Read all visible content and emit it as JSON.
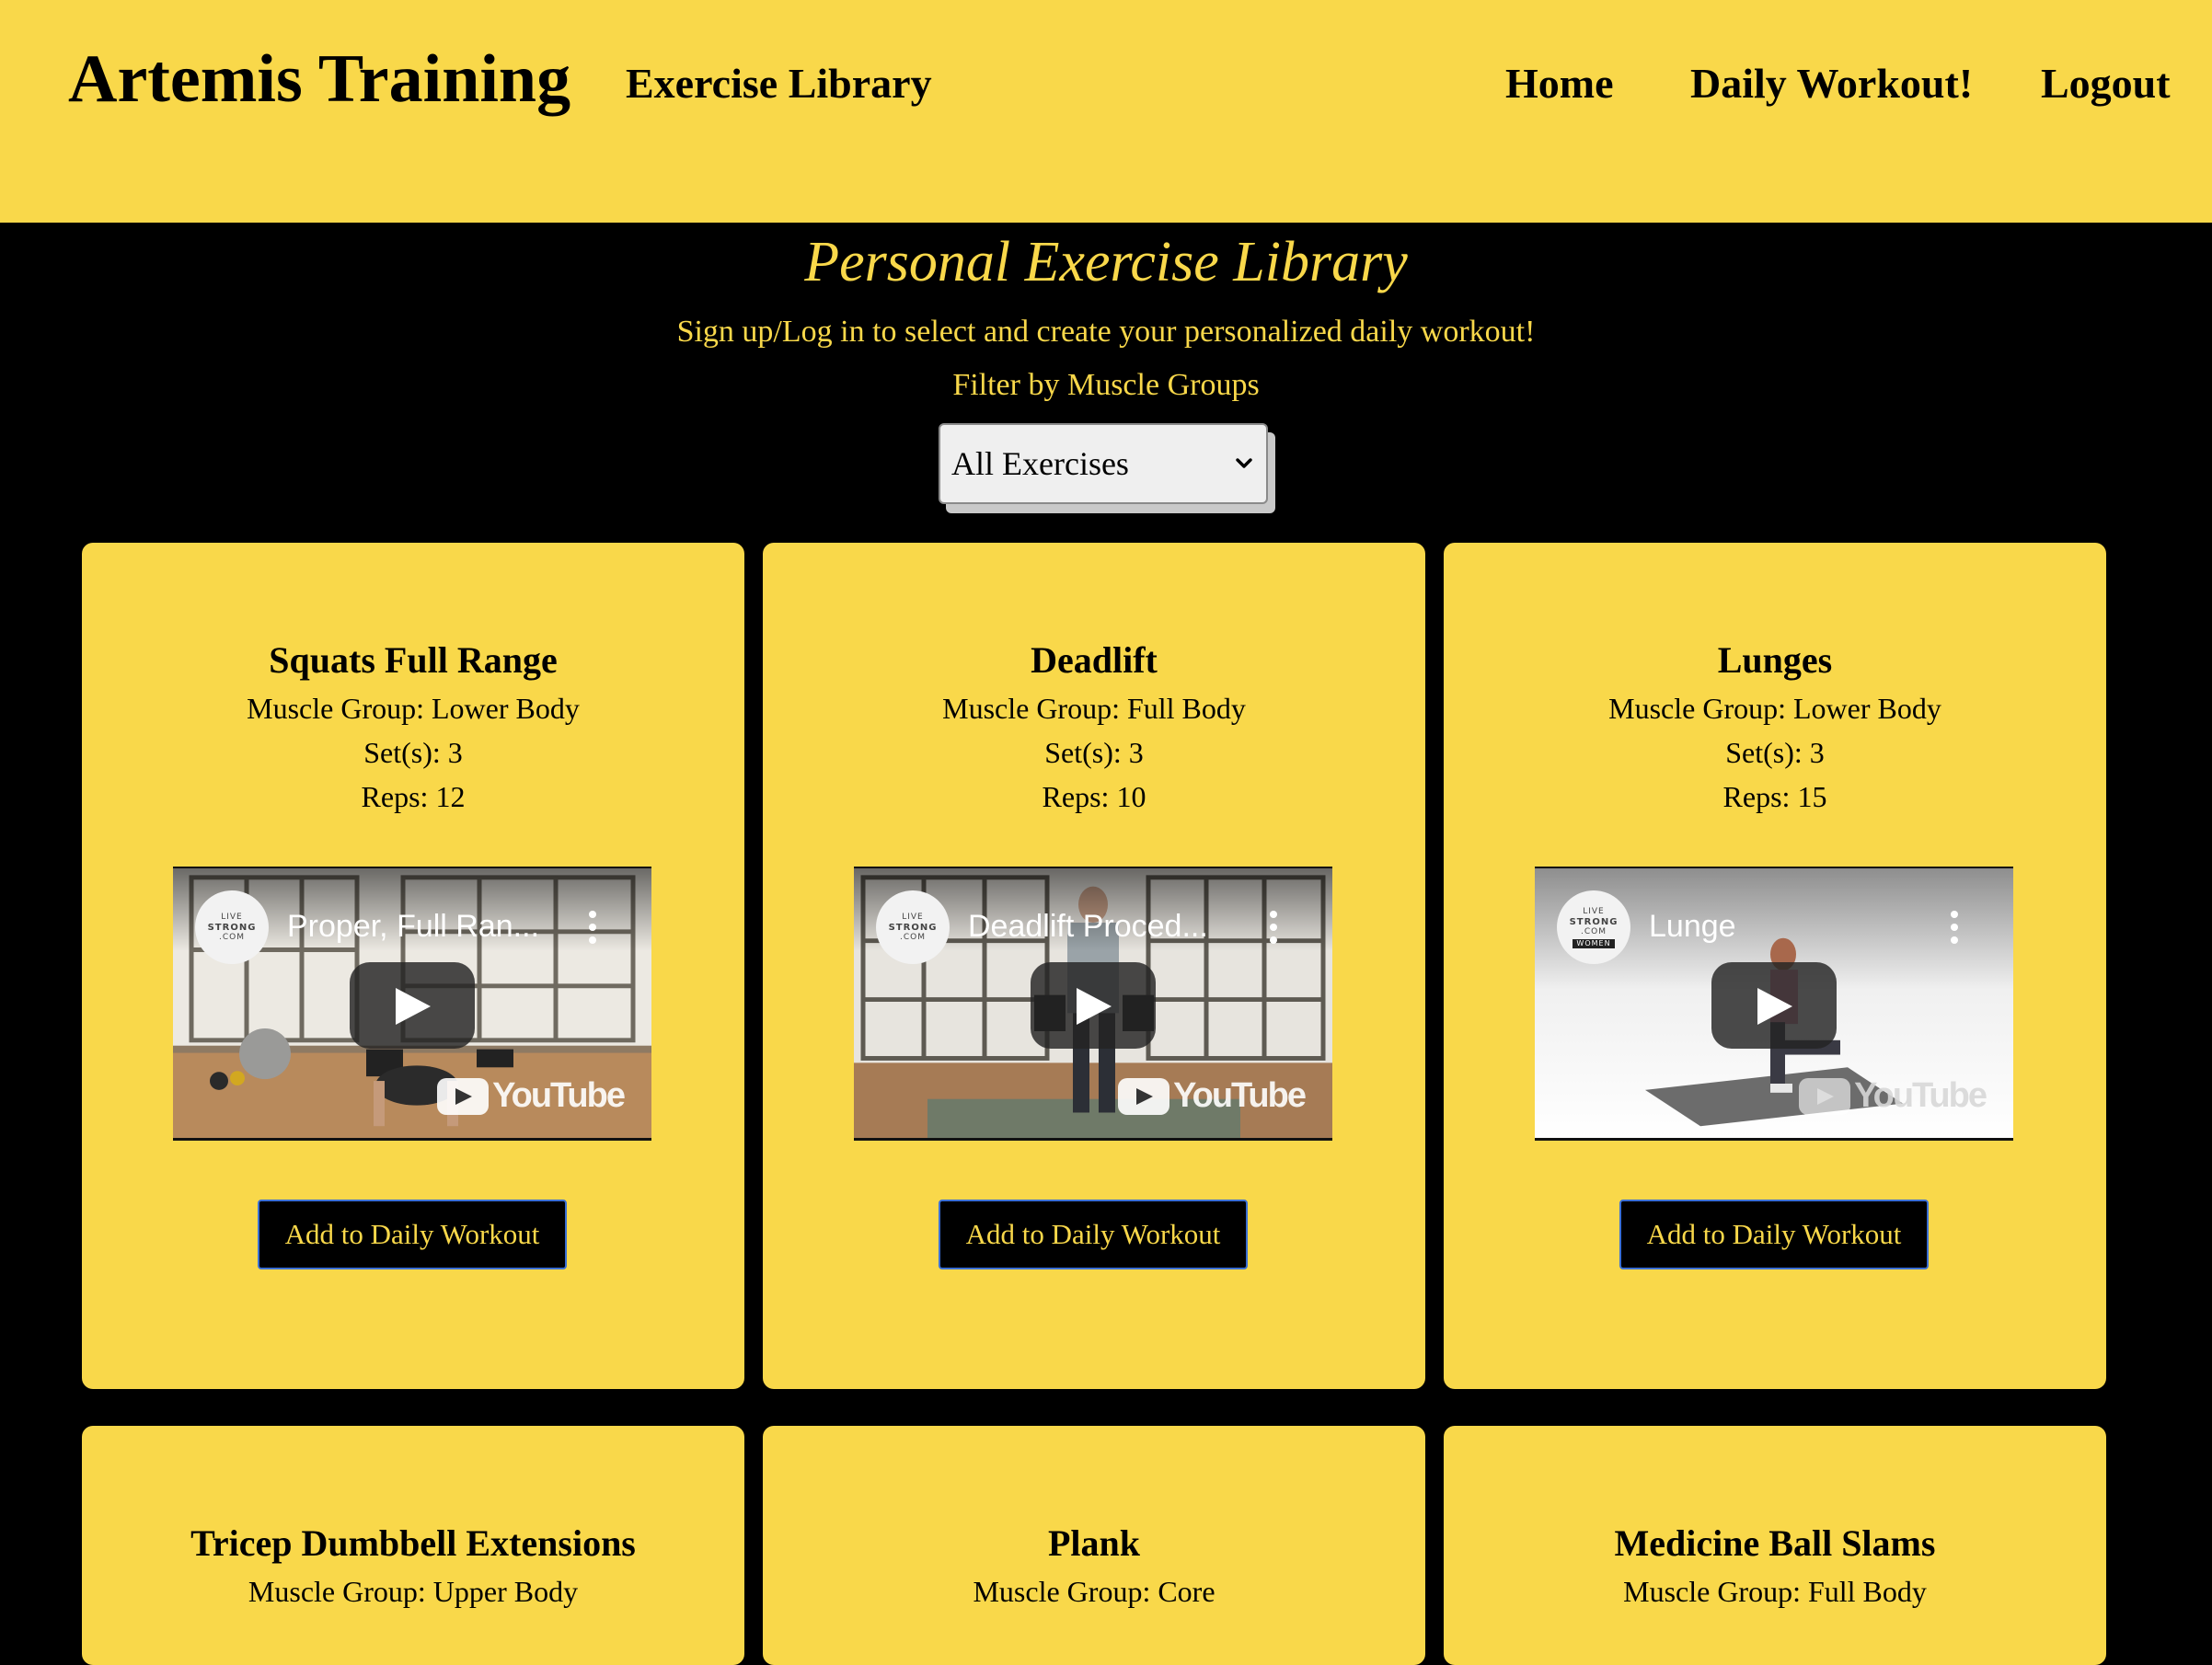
{
  "header": {
    "brand": "Artemis Training",
    "nav": {
      "library": "Exercise Library",
      "home": "Home",
      "daily": "Daily Workout!",
      "logout": "Logout"
    }
  },
  "main": {
    "title": "Personal Exercise Library",
    "subtitle": "Sign up/Log in to select and create your personalized daily workout!",
    "filter_label": "Filter by Muscle Groups",
    "filter_selected": "All Exercises"
  },
  "cards": [
    {
      "title": "Squats Full Range",
      "muscle": "Muscle Group: Lower Body",
      "sets": "Set(s): 3",
      "reps": "Reps: 12",
      "video_title": "Proper, Full Ran...",
      "button": "Add to Daily Workout"
    },
    {
      "title": "Deadlift",
      "muscle": "Muscle Group: Full Body",
      "sets": "Set(s): 3",
      "reps": "Reps: 10",
      "video_title": "Deadlift Proced...",
      "button": "Add to Daily Workout"
    },
    {
      "title": "Lunges",
      "muscle": "Muscle Group: Lower Body",
      "sets": "Set(s): 3",
      "reps": "Reps: 15",
      "video_title": "Lunge",
      "button": "Add to Daily Workout"
    },
    {
      "title": "Tricep Dumbbell Extensions",
      "muscle": "Muscle Group: Upper Body"
    },
    {
      "title": "Plank",
      "muscle": "Muscle Group: Core"
    },
    {
      "title": "Medicine Ball Slams",
      "muscle": "Muscle Group: Full Body"
    }
  ],
  "video_common": {
    "logo_top": "LIVE",
    "logo_mid": "STRONG",
    "logo_bottom": ".COM",
    "logo_women": "WOMEN",
    "youtube": "YouTube"
  },
  "colors": {
    "accent_yellow": "#f9d84a",
    "background": "#000000",
    "button_border": "#3b6fd4"
  },
  "icons": [
    "chevron-down-icon",
    "play-icon",
    "more-vert-icon",
    "youtube-logo-icon",
    "livestrong-logo-icon"
  ]
}
